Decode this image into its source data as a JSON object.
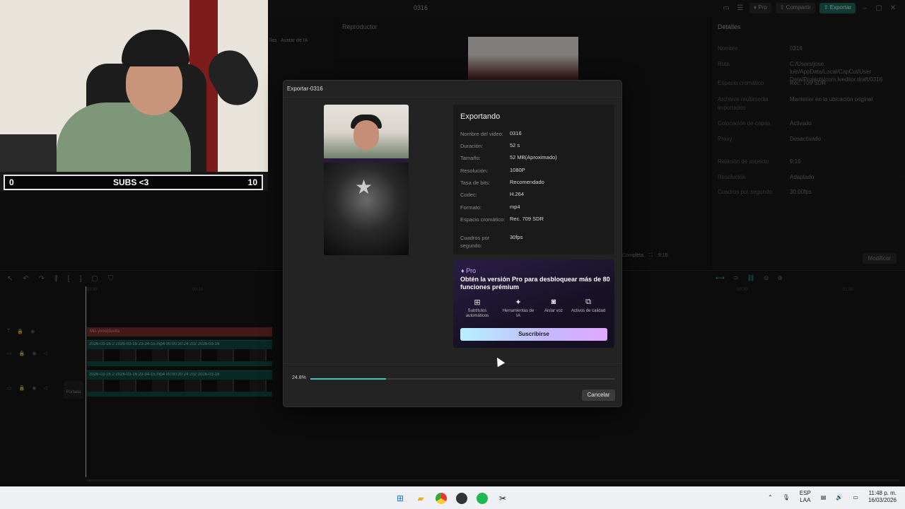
{
  "app": {
    "window_title": "0316",
    "pro_label": "Pro",
    "share_label": "Compartir",
    "export_label": "Exportar",
    "left_tab_1": "llas",
    "left_tab_2": "Avatar de IA",
    "player_title": "Reproductor",
    "player_controls": [
      "Completa",
      "9:16"
    ]
  },
  "details": {
    "title": "Detalles",
    "rows": [
      {
        "key": "Nombre",
        "value": "0316"
      },
      {
        "key": "Ruta",
        "value": "C:/Users/jose luis/AppData/Local/CapCut/User Data/Projects/com.lveditor.draft/0316"
      },
      {
        "key": "Espacio cromático",
        "value": "Rec. 709 SDR"
      },
      {
        "key": "Archivos multimedia importados",
        "value": "Mantener en la ubicación original"
      },
      {
        "key": "Colocación de capas",
        "value": "Activado"
      },
      {
        "key": "Proxy",
        "value": "Desactivado"
      },
      {
        "key": "Relación de aspecto",
        "value": "9:16"
      },
      {
        "key": "Resolución",
        "value": "Adaptado"
      },
      {
        "key": "Cuadros por segundo",
        "value": "30.00fps"
      }
    ],
    "modify_label": "Modificar"
  },
  "timeline": {
    "ruler": [
      "00:00",
      "00:10",
      "00:30",
      "01:00"
    ],
    "text_clip": "Mis yooo(duvita",
    "video_clip_1": "2026-03-16 2   2026-03-16 23-34-15.mp4   00:00:30:24     202   2026-03-16",
    "video_clip_2": "2026-03-16 2   2026-03-16 23-34-15.mp4   00:00:30:24     202   2026-03-16",
    "cover_label": "Portada"
  },
  "overlay": {
    "subs_left": "0",
    "subs_center": "SUBS <3",
    "subs_right": "10"
  },
  "dialog": {
    "title": "Exportar-0316",
    "status": "Exportando",
    "info": [
      {
        "key": "Nombre del video:",
        "value": "0316"
      },
      {
        "key": "Duración:",
        "value": "52 s"
      },
      {
        "key": "Tamaño:",
        "value": "52 MB(Aproximado)"
      },
      {
        "key": "Resolución:",
        "value": "1080P"
      },
      {
        "key": "Tasa de bits:",
        "value": "Recomendado"
      },
      {
        "key": "Codec:",
        "value": "H.264"
      },
      {
        "key": "Formato:",
        "value": "mp4"
      },
      {
        "key": "Espacio cromático:",
        "value": "Rec. 709 SDR"
      },
      {
        "key": "Cuadros por segundo:",
        "value": "30fps"
      }
    ],
    "pro": {
      "badge": "Pro",
      "headline": "Obtén la versión Pro para desbloquear más de 80 funciones prémium",
      "features": [
        {
          "label": "Subtítulos automáticos",
          "icon": "grid-icon"
        },
        {
          "label": "Herramientas de IA",
          "icon": "magic-wand-icon"
        },
        {
          "label": "Aislar voz",
          "icon": "voice-icon"
        },
        {
          "label": "Activos de calidad",
          "icon": "asset-icon"
        }
      ],
      "subscribe_label": "Suscribirse"
    },
    "progress_text": "24.8%",
    "progress_value": 0.248,
    "cancel_label": "Cancelar"
  },
  "taskbar": {
    "lang_1": "ESP",
    "lang_2": "LAA",
    "time": "11:48 p. m.",
    "date": "16/03/2026"
  },
  "colors": {
    "accent": "#38c5c0",
    "pro_purple": "#c9a9ff",
    "export_green": "#1f6b5f"
  }
}
